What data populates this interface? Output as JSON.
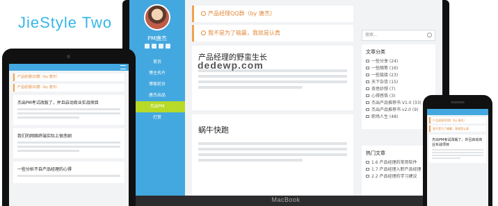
{
  "brand": {
    "title": "JieStyle Two"
  },
  "laptop": {
    "bezel_label": "MacBook",
    "sidebar": {
      "name": "PM唐杰",
      "social_icons": [
        "weibo-icon",
        "rss-icon",
        "wechat-icon",
        "facebook-icon"
      ],
      "nav": [
        "首页",
        "博主名片",
        "博客前台",
        "唐杰出品",
        "杰出PM",
        "打赏"
      ],
      "active_index": 4
    },
    "notices": [
      {
        "text": "产品经理QQ群（by 唐杰）"
      },
      {
        "text": "我不是为了输赢，我就是认真"
      }
    ],
    "posts": [
      {
        "title": "产品经理的野蛮生长",
        "watermark": "dedewp.com"
      },
      {
        "title": "蜗牛快跑"
      }
    ],
    "right": {
      "search_placeholder": "搜索...",
      "categories_title": "文章分类",
      "categories": [
        "一些分享 (24)",
        "一些随笔 (16)",
        "一些链接 (23)",
        "天下杂货 (15)",
        "奇思妙想 (7)",
        "心得感悟 (3)",
        "杰出产品推荐书 V1.0 (33)",
        "杰出产品推荐书 v2.0 (9)",
        "职场人生 (48)"
      ],
      "hot_title": "热门文章",
      "hot_posts": [
        "1.6 产品经理的常用软件",
        "1.7 产品经理入职产品经理",
        "2.2 产品经理的学习建议"
      ]
    }
  },
  "tablet": {
    "notices": [
      "产品经理QQ群（by 唐杰）",
      "产品经理QQ群（by 唐杰）"
    ],
    "posts": [
      {
        "title": "杰出PM考试改版了，并且启动商业实战项目"
      },
      {
        "title": "我们的网络终端实际上很悲剧"
      },
      {
        "title": "一些分析不自产品经理的心得"
      }
    ]
  },
  "phone": {
    "notices": [
      "产品经理QQ群（by 唐杰）",
      "我不是为了输赢，我就是认真"
    ],
    "posts": [
      {
        "title": "杰出PM考试改版了，并且启动商业实战项目"
      }
    ]
  },
  "colors": {
    "accent": "#43a8df",
    "brand": "#35b6e8",
    "notice": "#f0a14d",
    "nav_active": "#b7d927"
  }
}
